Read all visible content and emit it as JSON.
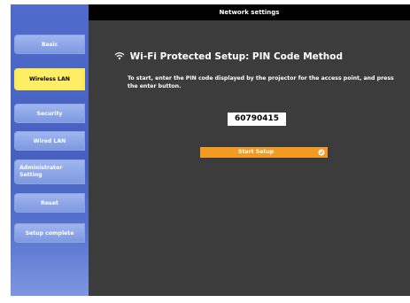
{
  "window": {
    "title": "Network settings"
  },
  "sidebar": {
    "items": [
      {
        "label": "Basic"
      },
      {
        "label": "Wireless LAN"
      },
      {
        "label": "Security"
      },
      {
        "label": "Wired LAN"
      },
      {
        "label": "Administrator\nSetting"
      },
      {
        "label": "Reset"
      },
      {
        "label": "Setup complete"
      }
    ],
    "active_item": "Wireless LAN"
  },
  "main": {
    "heading": "Wi-Fi Protected Setup: PIN Code Method",
    "instructions": "To start, enter the PIN code displayed by the projector for the access point, and press the enter button.",
    "pin_code": "60790415",
    "start_button": "Start Setup"
  },
  "icons": {
    "heading_icon": "wifi-signal-icon",
    "start_icon": "enter-icon"
  },
  "colors": {
    "active_menu": "#ffee66",
    "start_button": "#f39a22",
    "sidebar": "#4f6bcb",
    "panel": "#3c3c3c"
  }
}
